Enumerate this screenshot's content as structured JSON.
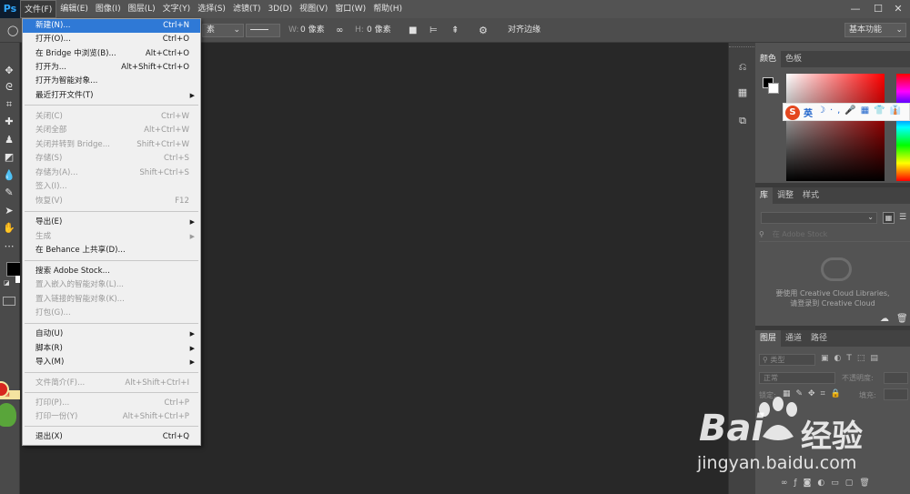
{
  "app": {
    "logo": "Ps"
  },
  "menubar": {
    "items": [
      "文件(F)",
      "编辑(E)",
      "图像(I)",
      "图层(L)",
      "文字(Y)",
      "选择(S)",
      "滤镜(T)",
      "3D(D)",
      "视图(V)",
      "窗口(W)",
      "帮助(H)"
    ],
    "window_controls": [
      "—",
      "☐",
      "✕"
    ]
  },
  "options_bar": {
    "w_label": "W:",
    "w_value": "0 像素",
    "h_label": "H:",
    "h_value": "0 像素",
    "shape_dropdown": "素",
    "align_edges_label": "对齐边缘",
    "workspace": "基本功能"
  },
  "file_menu": {
    "items": [
      {
        "label": "新建(N)...",
        "shortcut": "Ctrl+N",
        "enabled": true,
        "selected": true
      },
      {
        "label": "打开(O)...",
        "shortcut": "Ctrl+O",
        "enabled": true
      },
      {
        "label": "在 Bridge 中浏览(B)...",
        "shortcut": "Alt+Ctrl+O",
        "enabled": true
      },
      {
        "label": "打开为...",
        "shortcut": "Alt+Shift+Ctrl+O",
        "enabled": true
      },
      {
        "label": "打开为智能对象...",
        "shortcut": "",
        "enabled": true
      },
      {
        "label": "最近打开文件(T)",
        "shortcut": "",
        "enabled": true,
        "submenu": true
      },
      {
        "label": "关闭(C)",
        "shortcut": "Ctrl+W",
        "enabled": false
      },
      {
        "label": "关闭全部",
        "shortcut": "Alt+Ctrl+W",
        "enabled": false
      },
      {
        "label": "关闭并转到 Bridge...",
        "shortcut": "Shift+Ctrl+W",
        "enabled": false
      },
      {
        "label": "存储(S)",
        "shortcut": "Ctrl+S",
        "enabled": false
      },
      {
        "label": "存储为(A)...",
        "shortcut": "Shift+Ctrl+S",
        "enabled": false
      },
      {
        "label": "签入(I)...",
        "shortcut": "",
        "enabled": false
      },
      {
        "label": "恢复(V)",
        "shortcut": "F12",
        "enabled": false
      },
      {
        "label": "导出(E)",
        "shortcut": "",
        "enabled": true,
        "submenu": true
      },
      {
        "label": "生成",
        "shortcut": "",
        "enabled": false,
        "submenu": true
      },
      {
        "label": "在 Behance 上共享(D)...",
        "shortcut": "",
        "enabled": true
      },
      {
        "label": "搜索 Adobe Stock...",
        "shortcut": "",
        "enabled": true
      },
      {
        "label": "置入嵌入的智能对象(L)...",
        "shortcut": "",
        "enabled": false
      },
      {
        "label": "置入链接的智能对象(K)...",
        "shortcut": "",
        "enabled": false
      },
      {
        "label": "打包(G)...",
        "shortcut": "",
        "enabled": false
      },
      {
        "label": "自动(U)",
        "shortcut": "",
        "enabled": true,
        "submenu": true
      },
      {
        "label": "脚本(R)",
        "shortcut": "",
        "enabled": true,
        "submenu": true
      },
      {
        "label": "导入(M)",
        "shortcut": "",
        "enabled": true,
        "submenu": true
      },
      {
        "label": "文件简介(F)...",
        "shortcut": "Alt+Shift+Ctrl+I",
        "enabled": false
      },
      {
        "label": "打印(P)...",
        "shortcut": "Ctrl+P",
        "enabled": false
      },
      {
        "label": "打印一份(Y)",
        "shortcut": "Alt+Shift+Ctrl+P",
        "enabled": false
      },
      {
        "label": "退出(X)",
        "shortcut": "Ctrl+Q",
        "enabled": true
      }
    ]
  },
  "color_panel": {
    "tabs": [
      "颜色",
      "色板"
    ]
  },
  "library_panel": {
    "tabs": [
      "库",
      "调整",
      "样式"
    ],
    "search_placeholder": "在 Adobe Stock",
    "message_line1": "要使用 Creative Cloud Libraries,",
    "message_line2": "请登录到 Creative Cloud"
  },
  "layers_panel": {
    "tabs": [
      "图层",
      "通道",
      "路径"
    ],
    "filter_label": "类型",
    "blend_mode": "正常",
    "opacity_label": "不透明度:",
    "lock_label": "锁定:",
    "fill_label": "填充:"
  },
  "ime_toolbar": {
    "mode": "英"
  },
  "watermark": {
    "brand": "Bai",
    "brand2": "经验",
    "url": "jingyan.baidu.com"
  },
  "colors": {
    "accent": "#2f79d6",
    "ps_blue": "#31a8ff",
    "panel": "#535353",
    "canvas": "#282828"
  }
}
